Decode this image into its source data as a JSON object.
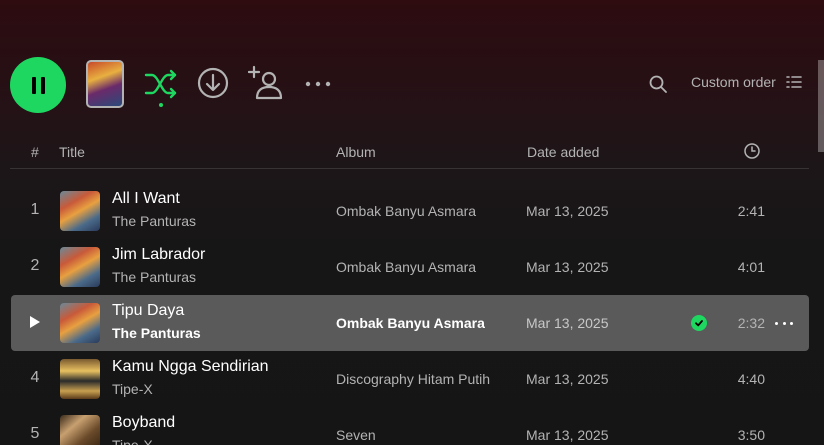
{
  "actions": {
    "sort_label": "Custom order"
  },
  "table": {
    "col_num": "#",
    "col_title": "Title",
    "col_album": "Album",
    "col_date": "Date added"
  },
  "tracks": [
    {
      "num": "1",
      "title": "All I Want",
      "artist": "The Panturas",
      "album": "Ombak Banyu Asmara",
      "date": "Mar 13, 2025",
      "duration": "2:41"
    },
    {
      "num": "2",
      "title": "Jim Labrador",
      "artist": "The Panturas",
      "album": "Ombak Banyu Asmara",
      "date": "Mar 13, 2025",
      "duration": "4:01"
    },
    {
      "num": "3",
      "title": "Tipu Daya",
      "artist": "The Panturas",
      "album": "Ombak Banyu Asmara",
      "date": "Mar 13, 2025",
      "duration": "2:32"
    },
    {
      "num": "4",
      "title": "Kamu Ngga Sendirian",
      "artist": "Tipe-X",
      "album": "Discography Hitam Putih",
      "date": "Mar 13, 2025",
      "duration": "4:40"
    },
    {
      "num": "5",
      "title": "Boyband",
      "artist": "Tipe-X",
      "album": "Seven",
      "date": "Mar 13, 2025",
      "duration": "3:50"
    }
  ],
  "colors": {
    "accent": "#1ed760",
    "row_highlight": "#5a5a5a"
  },
  "icons": [
    "pause-icon",
    "shuffle-icon",
    "download-icon",
    "invite-collaborator-icon",
    "more-icon",
    "search-icon",
    "list-icon",
    "clock-icon",
    "play-icon",
    "check-icon"
  ]
}
